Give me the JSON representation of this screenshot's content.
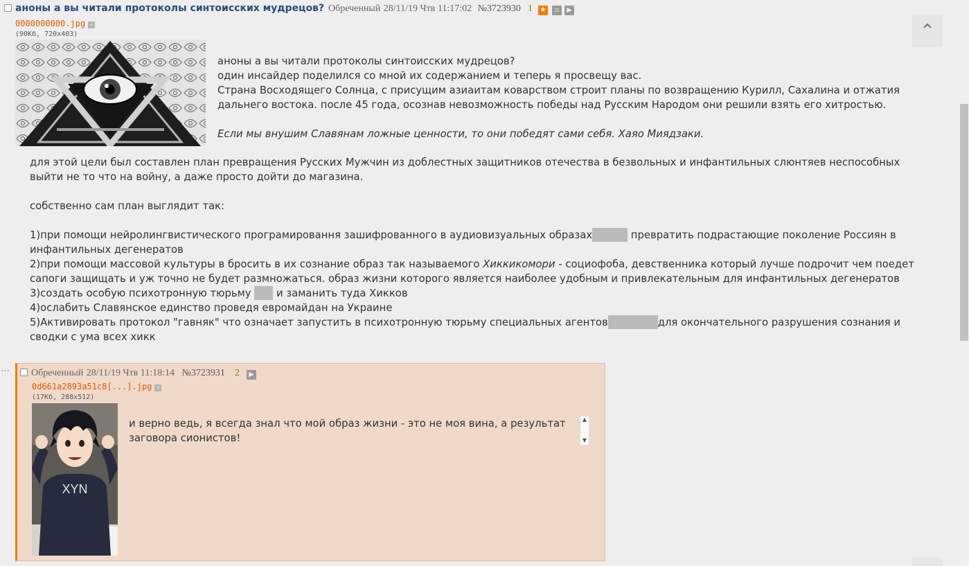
{
  "oppost": {
    "title": "аноны а вы читали протоколы синтоисских мудрецов?",
    "author": "Обреченный",
    "date": "28/11/19 Чтв 11:17:02",
    "number": "№3723930",
    "reply_count": "1",
    "file": {
      "name": "0000000000.jpg",
      "info": "(90Кб, 720x403)"
    },
    "text": {
      "p1": "аноны а вы читали протоколы синтоисских мудрецов?",
      "p2": "один инсайдер поделился со мной их содержанием и теперь я просвещу вас.",
      "p3": "Страна Восходящего Солнца, с присущим азиаитам коварством строит планы по возвращению Курилл, Сахалина и отжатия дальнего востока. после 45 года, осознав невозможность победы над Русским Народом они решили взять его хитростью.",
      "quote": "Если мы внушим Славянам ложные ценности, то они победят сами себя. Хаяо Миядзаки.",
      "p4": "для этой цели был составлен план превращения Русских Мужчин из доблестных защитников отечества в безвольных и инфантильных слюнтяев неспособных выйти не то что на войну, а даже просто дойти до магазина.",
      "p5": "собственно сам план выглядит так:",
      "item1_a": "1)при помощи нейролингвистического програмировання зашифрованного в аудиовизуальных образах",
      "item1_b": " превратить подрастающие поколение Россиян в инфантильных дегенератов",
      "item2_a": "2)при помощи массовой культуры в бросить в их сознание образ так называемого ",
      "item2_em": "Хиккикомори",
      "item2_b": " - социофоба, девственника который лучше подрочит чем поедет сапоги защищать и уж точно не будет размножаться. образ жизни которого является наиболее удобным и привлекательным для инфантильных дегенератов",
      "item3_a": "3)создать особую психотронную тюрьму ",
      "item3_b": " и заманить туда Хикков",
      "item4": "4)ослабить Славянское единство проведя евромайдан на Украине",
      "item5_a": "5)Активировать протокол \"гавняк\" что означает запустить в психотронную тюрьму специальных агентов",
      "item5_b": "для окончательного разрушения сознания и сводки с ума всех хикк"
    }
  },
  "reply": {
    "author": "Обреченный",
    "date": "28/11/19 Чтв 11:18:14",
    "number": "№3723931",
    "reply_count": "2",
    "file": {
      "name": "0d661a2893a51c8[...].jpg",
      "info": "(17Кб, 288x512)"
    },
    "text": "и верно ведь, я всегда знал что мой образ жизни - это не моя вина, а результат заговора сионистов!",
    "image_shirt_text": "XYN"
  },
  "ui": {
    "dots": "⋯",
    "scroll_up_icon": "⌃"
  },
  "colors": {
    "title": "#2b4a7a",
    "file_link": "#e05a00",
    "reply_bg": "#f0d9c9",
    "reply_accent": "#f07d00",
    "count": "#7a8a00"
  }
}
